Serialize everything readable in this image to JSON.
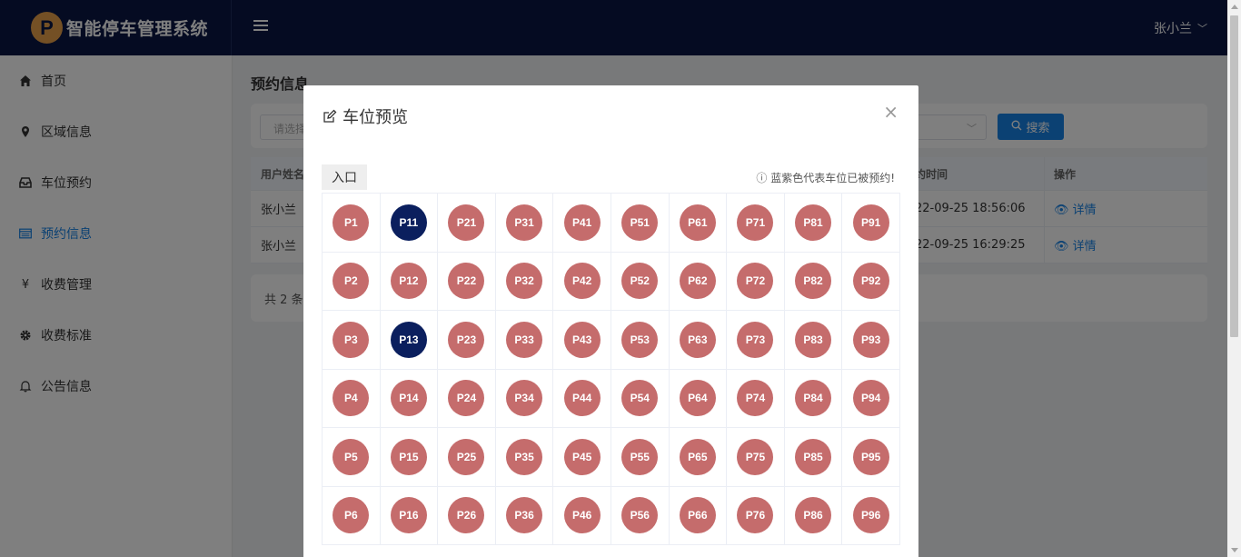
{
  "app": {
    "logo_letter": "P",
    "title": "智能停车管理系统",
    "user": "张小兰"
  },
  "sidebar": {
    "items": [
      {
        "label": "首页",
        "icon": "home-icon"
      },
      {
        "label": "区域信息",
        "icon": "location-pin-icon"
      },
      {
        "label": "车位预约",
        "icon": "inbox-icon"
      },
      {
        "label": "预约信息",
        "icon": "list-icon",
        "active": true
      },
      {
        "label": "收费管理",
        "icon": "yen-icon"
      },
      {
        "label": "收费标准",
        "icon": "gear-icon"
      },
      {
        "label": "公告信息",
        "icon": "bell-icon"
      }
    ]
  },
  "main": {
    "title": "预约信息",
    "search": {
      "placeholder": "请选择",
      "button": "搜索"
    },
    "table": {
      "headers": [
        "用户姓名",
        "约时间",
        "操作"
      ],
      "rows": [
        {
          "name": "张小兰",
          "time": "22-09-25 18:56:06",
          "action": "详情"
        },
        {
          "name": "张小兰",
          "time": "22-09-25 16:29:25",
          "action": "详情"
        }
      ]
    },
    "pager_text": "共 2 条"
  },
  "dialog": {
    "title": "车位预览",
    "entrance_label": "入口",
    "note": "蓝紫色代表车位已被预约!",
    "colors": {
      "available": "#c56c6c",
      "reserved": "#0b1f5e"
    },
    "rows": [
      [
        "P1",
        "P11",
        "P21",
        "P31",
        "P41",
        "P51",
        "P61",
        "P71",
        "P81",
        "P91"
      ],
      [
        "P2",
        "P12",
        "P22",
        "P32",
        "P42",
        "P52",
        "P62",
        "P72",
        "P82",
        "P92"
      ],
      [
        "P3",
        "P13",
        "P23",
        "P33",
        "P43",
        "P53",
        "P63",
        "P73",
        "P83",
        "P93"
      ],
      [
        "P4",
        "P14",
        "P24",
        "P34",
        "P44",
        "P54",
        "P64",
        "P74",
        "P84",
        "P94"
      ],
      [
        "P5",
        "P15",
        "P25",
        "P35",
        "P45",
        "P55",
        "P65",
        "P75",
        "P85",
        "P95"
      ],
      [
        "P6",
        "P16",
        "P26",
        "P36",
        "P46",
        "P56",
        "P66",
        "P76",
        "P86",
        "P96"
      ]
    ],
    "reserved": [
      "P11",
      "P13"
    ]
  }
}
